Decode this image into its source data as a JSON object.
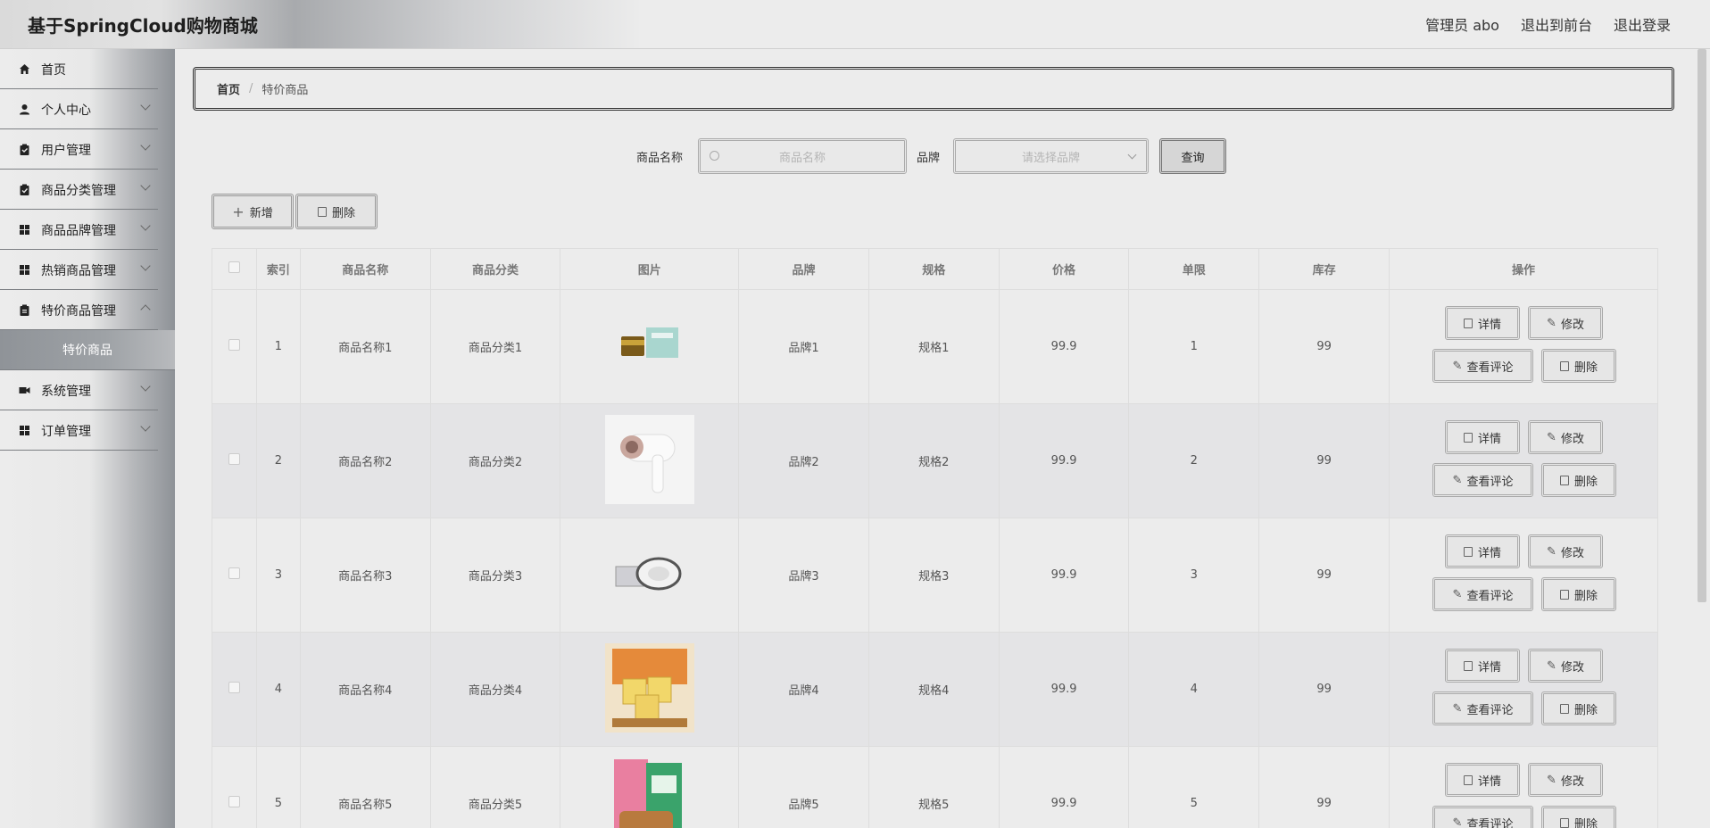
{
  "header": {
    "app_title": "基于SpringCloud购物商城",
    "admin_label": "管理员 abo",
    "front_link": "退出到前台",
    "logout_link": "退出登录"
  },
  "sidebar": {
    "items": [
      {
        "label": "首页",
        "icon": "home-icon"
      },
      {
        "label": "个人中心",
        "icon": "user-icon"
      },
      {
        "label": "用户管理",
        "icon": "clipboard-icon"
      },
      {
        "label": "商品分类管理",
        "icon": "clipboard-check-icon"
      },
      {
        "label": "商品品牌管理",
        "icon": "grid-icon"
      },
      {
        "label": "热销商品管理",
        "icon": "grid-icon"
      },
      {
        "label": "特价商品管理",
        "icon": "clipboard-icon"
      },
      {
        "label": "特价商品",
        "icon": ""
      },
      {
        "label": "系统管理",
        "icon": "video-icon"
      },
      {
        "label": "订单管理",
        "icon": "grid-icon"
      }
    ]
  },
  "breadcrumb": {
    "home": "首页",
    "separator": "/",
    "current": "特价商品"
  },
  "search": {
    "name_label": "商品名称",
    "name_placeholder": "商品名称",
    "brand_label": "品牌",
    "brand_placeholder": "请选择品牌",
    "query_button": "查询"
  },
  "toolbar": {
    "add_button": "新增",
    "delete_button": "删除"
  },
  "table": {
    "headers": [
      "索引",
      "商品名称",
      "商品分类",
      "图片",
      "品牌",
      "规格",
      "价格",
      "单限",
      "库存",
      "操作"
    ],
    "rows": [
      {
        "index": "1",
        "name": "商品名称1",
        "category": "商品分类1",
        "brand": "品牌1",
        "spec": "规格1",
        "price": "99.9",
        "limit": "1",
        "stock": "99"
      },
      {
        "index": "2",
        "name": "商品名称2",
        "category": "商品分类2",
        "brand": "品牌2",
        "spec": "规格2",
        "price": "99.9",
        "limit": "2",
        "stock": "99"
      },
      {
        "index": "3",
        "name": "商品名称3",
        "category": "商品分类3",
        "brand": "品牌3",
        "spec": "规格3",
        "price": "99.9",
        "limit": "3",
        "stock": "99"
      },
      {
        "index": "4",
        "name": "商品名称4",
        "category": "商品分类4",
        "brand": "品牌4",
        "spec": "规格4",
        "price": "99.9",
        "limit": "4",
        "stock": "99"
      },
      {
        "index": "5",
        "name": "商品名称5",
        "category": "商品分类5",
        "brand": "品牌5",
        "spec": "规格5",
        "price": "99.9",
        "limit": "5",
        "stock": "99"
      }
    ],
    "actions": {
      "detail": "详情",
      "edit": "修改",
      "review": "查看评论",
      "delete": "删除"
    }
  }
}
